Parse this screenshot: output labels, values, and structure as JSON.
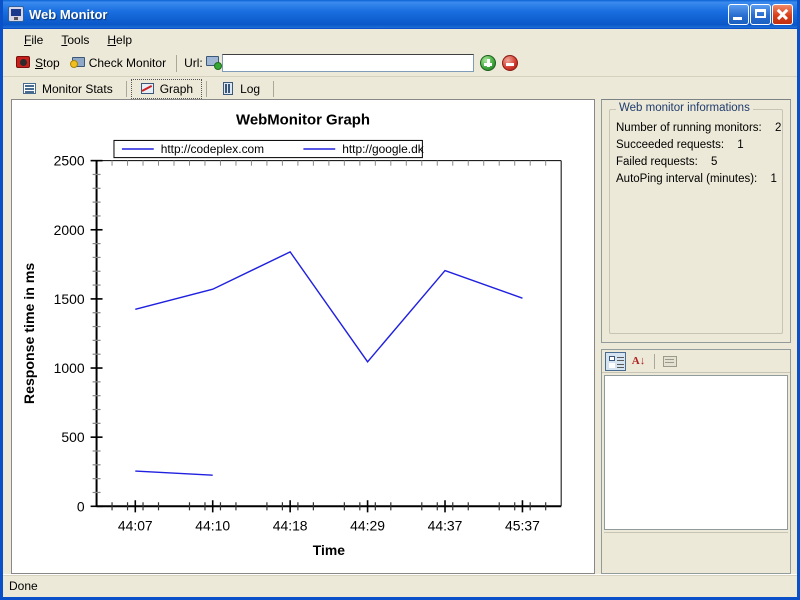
{
  "window": {
    "title": "Web Monitor",
    "icon": "monitor-icon",
    "minimize_label": "Minimize",
    "maximize_label": "Maximize",
    "close_label": "Close"
  },
  "menu": {
    "items": [
      {
        "label": "File",
        "mnemonic": "F"
      },
      {
        "label": "Tools",
        "mnemonic": "T"
      },
      {
        "label": "Help",
        "mnemonic": "H"
      }
    ]
  },
  "toolbar": {
    "stop_label": "Stop",
    "stop_mnemonic": "S",
    "check_monitor_label": "Check Monitor",
    "url_label": "Url:",
    "url_value": "",
    "url_placeholder": "",
    "add_label": "Add",
    "remove_label": "Remove"
  },
  "tabs": [
    {
      "label": "Monitor Stats",
      "icon": "list-icon",
      "active": false
    },
    {
      "label": "Graph",
      "icon": "graph-icon",
      "active": true
    },
    {
      "label": "Log",
      "icon": "document-icon",
      "active": false
    }
  ],
  "info_panel": {
    "group_title": "Web monitor informations",
    "rows": [
      {
        "label": "Number of running  monitors:",
        "value": "2"
      },
      {
        "label": "Succeeded requests:",
        "value": "1"
      },
      {
        "label": "Failed requests:",
        "value": "5"
      },
      {
        "label": "AutoPing interval (minutes):",
        "value": "1"
      }
    ]
  },
  "property_panel": {
    "categorized_label": "Categorized",
    "alphabetical_label": "Alphabetical",
    "property_pages_label": "Property Pages",
    "grid_content": "",
    "description_content": ""
  },
  "statusbar": {
    "text": "Done"
  },
  "chart_data": {
    "type": "line",
    "title": "WebMonitor Graph",
    "xlabel": "Time",
    "ylabel": "Response time in ms",
    "categories": [
      "44:07",
      "44:10",
      "44:18",
      "44:29",
      "44:37",
      "45:37"
    ],
    "ylim": [
      0,
      2500
    ],
    "ytick_step": 500,
    "yticks": [
      0,
      500,
      1000,
      1500,
      2000,
      2500
    ],
    "minor_ticks_per_interval": 5,
    "grid": false,
    "legend_position": "top",
    "line_color": "#2020e0",
    "series": [
      {
        "name": "http://codeplex.com",
        "color": "#2020e0",
        "x": [
          "44:07",
          "44:10"
        ],
        "values": [
          255,
          225
        ]
      },
      {
        "name": "http://google.dk",
        "color": "#2020e0",
        "x": [
          "44:07",
          "44:10",
          "44:18",
          "44:29",
          "44:37",
          "45:37"
        ],
        "values": [
          1425,
          1570,
          1840,
          1045,
          1705,
          1505
        ]
      }
    ]
  }
}
